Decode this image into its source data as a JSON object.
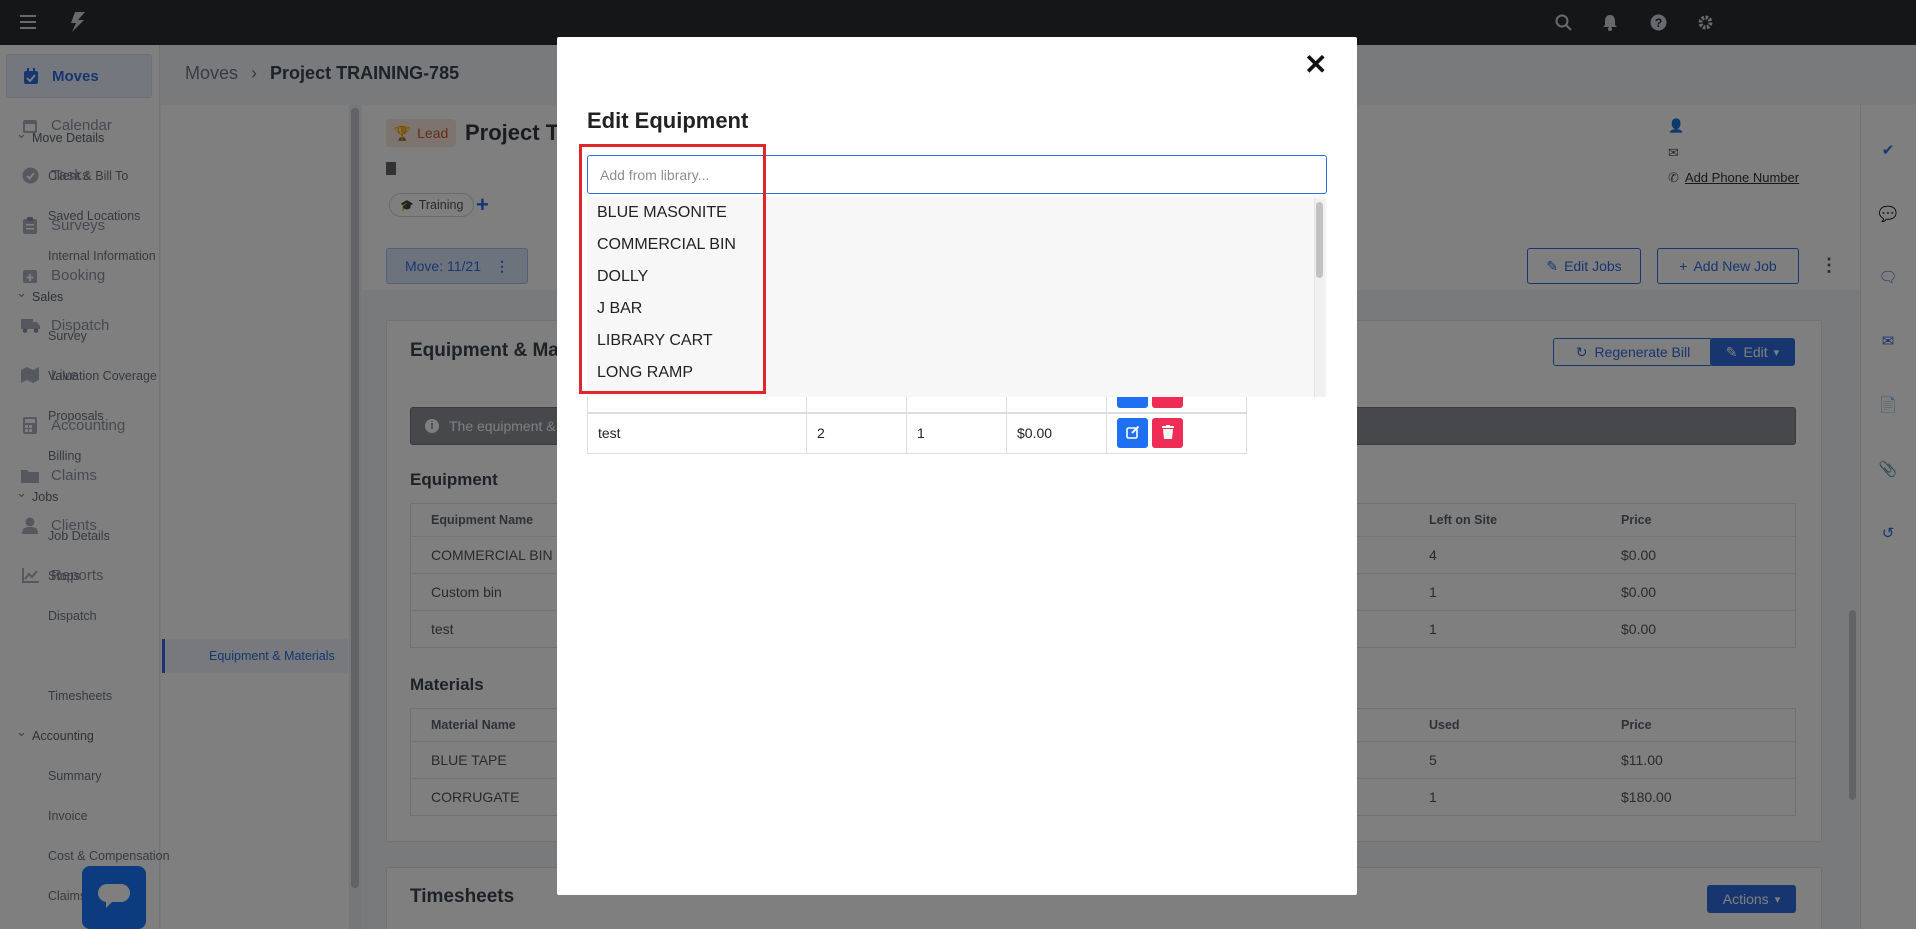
{
  "topbar": {
    "icons": [
      "menu-icon",
      "bolt-logo-icon",
      "search-icon",
      "bell-icon",
      "help-icon",
      "gear-icon"
    ]
  },
  "nav": {
    "items": [
      {
        "label": "Moves",
        "icon": "calendar-check-icon",
        "active": true
      },
      {
        "label": "Calendar",
        "icon": "calendar-icon"
      },
      {
        "label": "Tasks",
        "icon": "check-circle-icon"
      },
      {
        "label": "Surveys",
        "icon": "clipboard-icon"
      },
      {
        "label": "Booking",
        "icon": "calendar-plus-icon"
      },
      {
        "label": "Dispatch",
        "icon": "truck-icon"
      },
      {
        "label": "Live",
        "icon": "map-icon"
      },
      {
        "label": "Accounting",
        "icon": "calculator-icon"
      },
      {
        "label": "Claims",
        "icon": "folder-icon"
      },
      {
        "label": "Clients",
        "icon": "user-icon"
      },
      {
        "label": "Reports",
        "icon": "chart-line-icon"
      }
    ]
  },
  "breadcrumb": {
    "root": "Moves",
    "current": "Project TRAINING-785"
  },
  "subnav": {
    "sections": [
      {
        "label": "Move Details",
        "items": [
          "Client & Bill To",
          "Saved Locations",
          "Internal Information"
        ]
      },
      {
        "label": "Sales",
        "items": [
          "Survey",
          "Valuation Coverage",
          "Proposals",
          "Billing"
        ]
      },
      {
        "label": "Jobs",
        "items": [
          "Job Details",
          "Stops",
          "Dispatch",
          "Equipment & Materials",
          "Timesheets"
        ]
      },
      {
        "label": "Accounting",
        "items": [
          "Summary",
          "Invoice",
          "Cost & Compensation",
          "Claims"
        ]
      }
    ],
    "active_item": "Equipment & Materials"
  },
  "header": {
    "lead_badge": "Lead",
    "project_title": "Project T",
    "tag": "Training",
    "move_button": "Move: 11/21",
    "edit_jobs": "Edit Jobs",
    "add_new_job": "Add New Job",
    "add_phone": "Add Phone Number"
  },
  "equipment_card": {
    "title": "Equipment & Mat",
    "regenerate": "Regenerate Bill",
    "edit": "Edit",
    "info_text": "The equipment &",
    "equipment_section": "Equipment",
    "equipment_headers": [
      "Equipment Name",
      "Left on Site",
      "Price"
    ],
    "equipment_rows": [
      {
        "name": "COMMERCIAL BIN",
        "left": "4",
        "price": "$0.00"
      },
      {
        "name": "Custom bin",
        "left": "1",
        "price": "$0.00"
      },
      {
        "name": "test",
        "left": "1",
        "price": "$0.00"
      }
    ],
    "materials_section": "Materials",
    "materials_headers": [
      "Material Name",
      "Used",
      "Price"
    ],
    "materials_rows": [
      {
        "name": "BLUE TAPE",
        "used": "5",
        "price": "$11.00"
      },
      {
        "name": "CORRUGATE",
        "used": "1",
        "price": "$180.00"
      }
    ]
  },
  "timesheets": {
    "title": "Timesheets",
    "actions": "Actions"
  },
  "modal": {
    "title": "Edit Equipment",
    "close": "✕",
    "search_placeholder": "Add from library...",
    "search_value": "",
    "library_items": [
      "BLUE MASONITE",
      "COMMERCIAL BIN",
      "DOLLY",
      "J BAR",
      "LIBRARY CART",
      "LONG RAMP"
    ],
    "table_row": {
      "name": "test",
      "qty": "2",
      "left": "1",
      "price": "$0.00"
    }
  },
  "colors": {
    "accent": "#2f6de1",
    "danger": "#ef2c55",
    "highlight": "#e0262b",
    "topbar": "#2b2d31"
  }
}
